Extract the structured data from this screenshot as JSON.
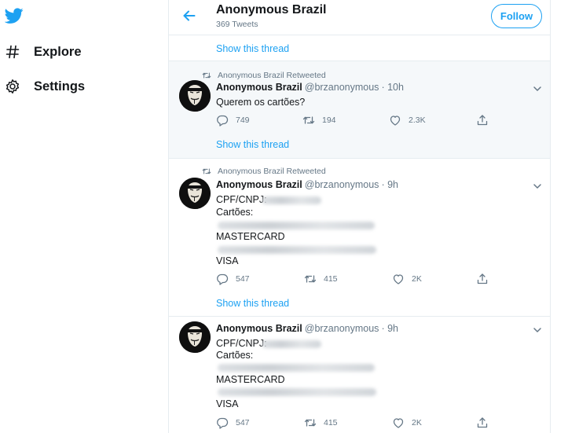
{
  "nav": {
    "explore_label": "Explore",
    "settings_label": "Settings"
  },
  "header": {
    "title": "Anonymous Brazil",
    "subtitle": "369 Tweets",
    "follow_label": "Follow"
  },
  "show_thread_label": "Show this thread",
  "tweets": [
    {
      "retweet_label": "Anonymous Brazil Retweeted",
      "name": "Anonymous Brazil",
      "handle": "@brzanonymous",
      "time": "· 10h",
      "lines": [
        "Querem os cartões?"
      ],
      "replies": "749",
      "retweets": "194",
      "likes": "2.3K"
    },
    {
      "retweet_label": "Anonymous Brazil Retweeted",
      "name": "Anonymous Brazil",
      "handle": "@brzanonymous",
      "time": "· 9h",
      "lines": [
        "CPF/CNPJ:",
        "Cartões:",
        "MASTERCARD",
        "VISA"
      ],
      "replies": "547",
      "retweets": "415",
      "likes": "2K"
    },
    {
      "name": "Anonymous Brazil",
      "handle": "@brzanonymous",
      "time": "· 9h",
      "lines": [
        "CPF/CNPJ:",
        "Cartões:",
        "MASTERCARD",
        "VISA"
      ],
      "replies": "547",
      "retweets": "415",
      "likes": "2K"
    }
  ],
  "icons": {
    "logo": "twitter-bird-icon",
    "explore": "hashtag-icon",
    "settings": "gear-icon",
    "back": "back-arrow-icon",
    "retweet": "retweet-icon",
    "reply": "reply-icon",
    "like": "heart-icon",
    "share": "share-icon",
    "menu": "chevron-down-icon"
  },
  "colors": {
    "accent": "#1da1f2",
    "muted": "#657786",
    "text": "#14171a",
    "highlight_bg": "#f5f8fa"
  }
}
